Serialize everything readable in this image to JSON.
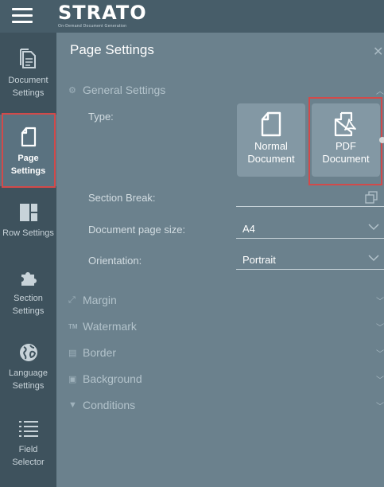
{
  "app": {
    "brand": "STRATO",
    "tagline": "On-Demand Document Generation"
  },
  "sidebar": {
    "items": [
      {
        "label1": "Document",
        "label2": "Settings",
        "icon": "document-icon"
      },
      {
        "label1": "Page",
        "label2": "Settings",
        "icon": "page-icon",
        "active": true
      },
      {
        "label1": "Row Settings",
        "label2": "",
        "icon": "row-layout-icon"
      },
      {
        "label1": "Section",
        "label2": "Settings",
        "icon": "puzzle-icon"
      },
      {
        "label1": "Language",
        "label2": "Settings",
        "icon": "globe-icon"
      },
      {
        "label1": "Field",
        "label2": "Selector",
        "icon": "list-icon"
      }
    ]
  },
  "panel": {
    "title": "Page Settings",
    "general": {
      "heading": "General Settings",
      "type_label": "Type:",
      "types": [
        {
          "line1": "Normal",
          "line2": "Document",
          "icon": "page-icon"
        },
        {
          "line1": "PDF",
          "line2": "Document",
          "icon": "pdf-icon",
          "highlighted": true
        }
      ],
      "section_break_label": "Section Break:",
      "page_size_label": "Document page size:",
      "page_size_value": "A4",
      "orientation_label": "Orientation:",
      "orientation_value": "Portrait"
    },
    "sections": [
      {
        "label": "Margin",
        "icon": "resize-icon"
      },
      {
        "label": "Watermark",
        "icon": "trademark-icon"
      },
      {
        "label": "Border",
        "icon": "border-icon"
      },
      {
        "label": "Background",
        "icon": "image-icon"
      },
      {
        "label": "Conditions",
        "icon": "filter-icon"
      }
    ]
  },
  "colors": {
    "highlight": "#d24a4a",
    "sidebar": "#3e525d",
    "panel": "#6b818d",
    "topbar": "#475d69"
  }
}
